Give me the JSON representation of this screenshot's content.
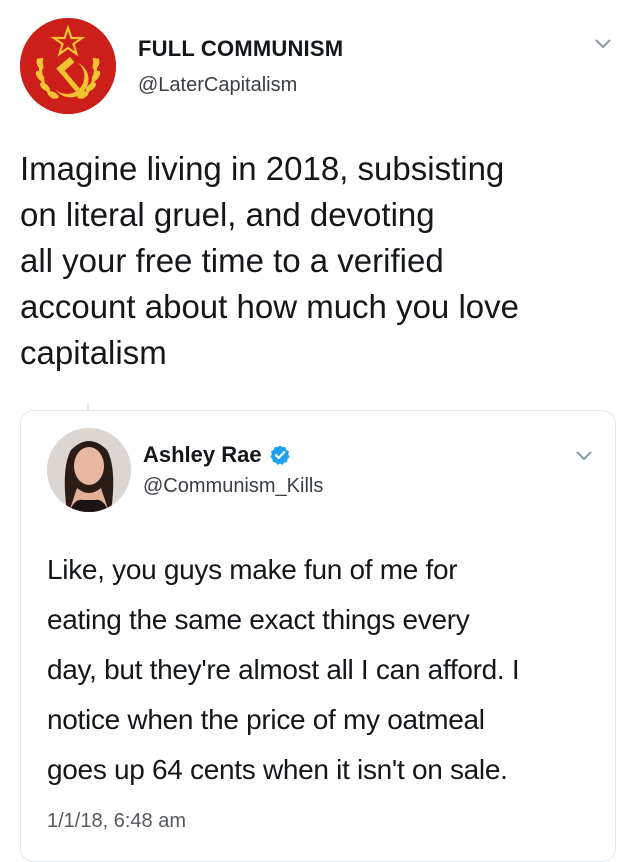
{
  "main_tweet": {
    "display_name": "FULL COMMUNISM",
    "handle": "@LaterCapitalism",
    "text": "Imagine living in 2018, subsisting\non literal gruel, and devoting\nall your free time to a verified\naccount about how much you love\ncapitalism",
    "avatar_icon": "hammer-sickle-star-wreath-icon",
    "avatar_color": "#cc1f1a",
    "menu_icon": "chevron-down-icon"
  },
  "quoted_tweet": {
    "display_name": "Ashley Rae",
    "verified_icon": "verified-badge-icon",
    "verified_color": "#1da1f2",
    "handle": "@Communism_Kills",
    "text": "Like, you guys make fun of me for\neating the same exact things every\nday, but they're almost all I can afford. I\nnotice when the price of my oatmeal\ngoes up 64 cents when it isn't on sale.",
    "timestamp": "1/1/18, 6:48 am",
    "menu_icon": "chevron-down-icon"
  }
}
